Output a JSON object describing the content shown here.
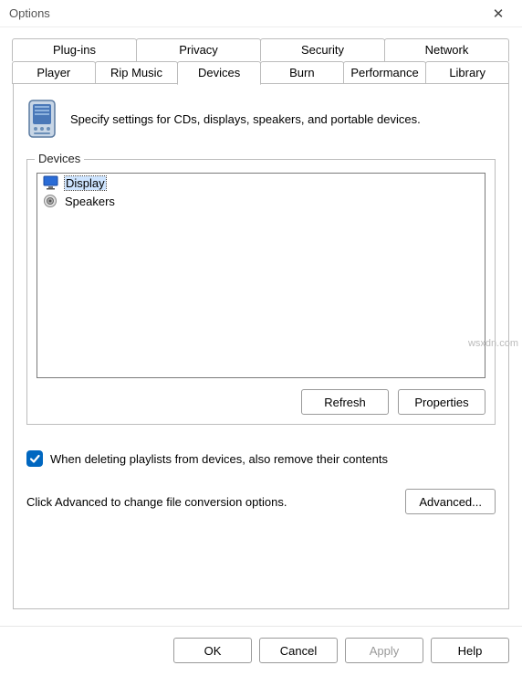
{
  "window": {
    "title": "Options",
    "close_label": "✕"
  },
  "tabs": {
    "row1": [
      "Plug-ins",
      "Privacy",
      "Security",
      "Network"
    ],
    "row2": [
      "Player",
      "Rip Music",
      "Devices",
      "Burn",
      "Performance",
      "Library"
    ],
    "active": "Devices"
  },
  "intro": {
    "text": "Specify settings for CDs, displays, speakers, and portable devices."
  },
  "devices_group": {
    "label": "Devices",
    "items": [
      {
        "label": "Display",
        "icon": "monitor",
        "selected": true
      },
      {
        "label": "Speakers",
        "icon": "speaker",
        "selected": false
      }
    ],
    "refresh_label": "Refresh",
    "properties_label": "Properties"
  },
  "checkbox": {
    "checked": true,
    "label": "When deleting playlists from devices, also remove their contents"
  },
  "advanced": {
    "text": "Click Advanced to change file conversion options.",
    "button_label": "Advanced..."
  },
  "footer": {
    "ok": "OK",
    "cancel": "Cancel",
    "apply": "Apply",
    "help": "Help"
  },
  "watermark": "wsxdn.com"
}
